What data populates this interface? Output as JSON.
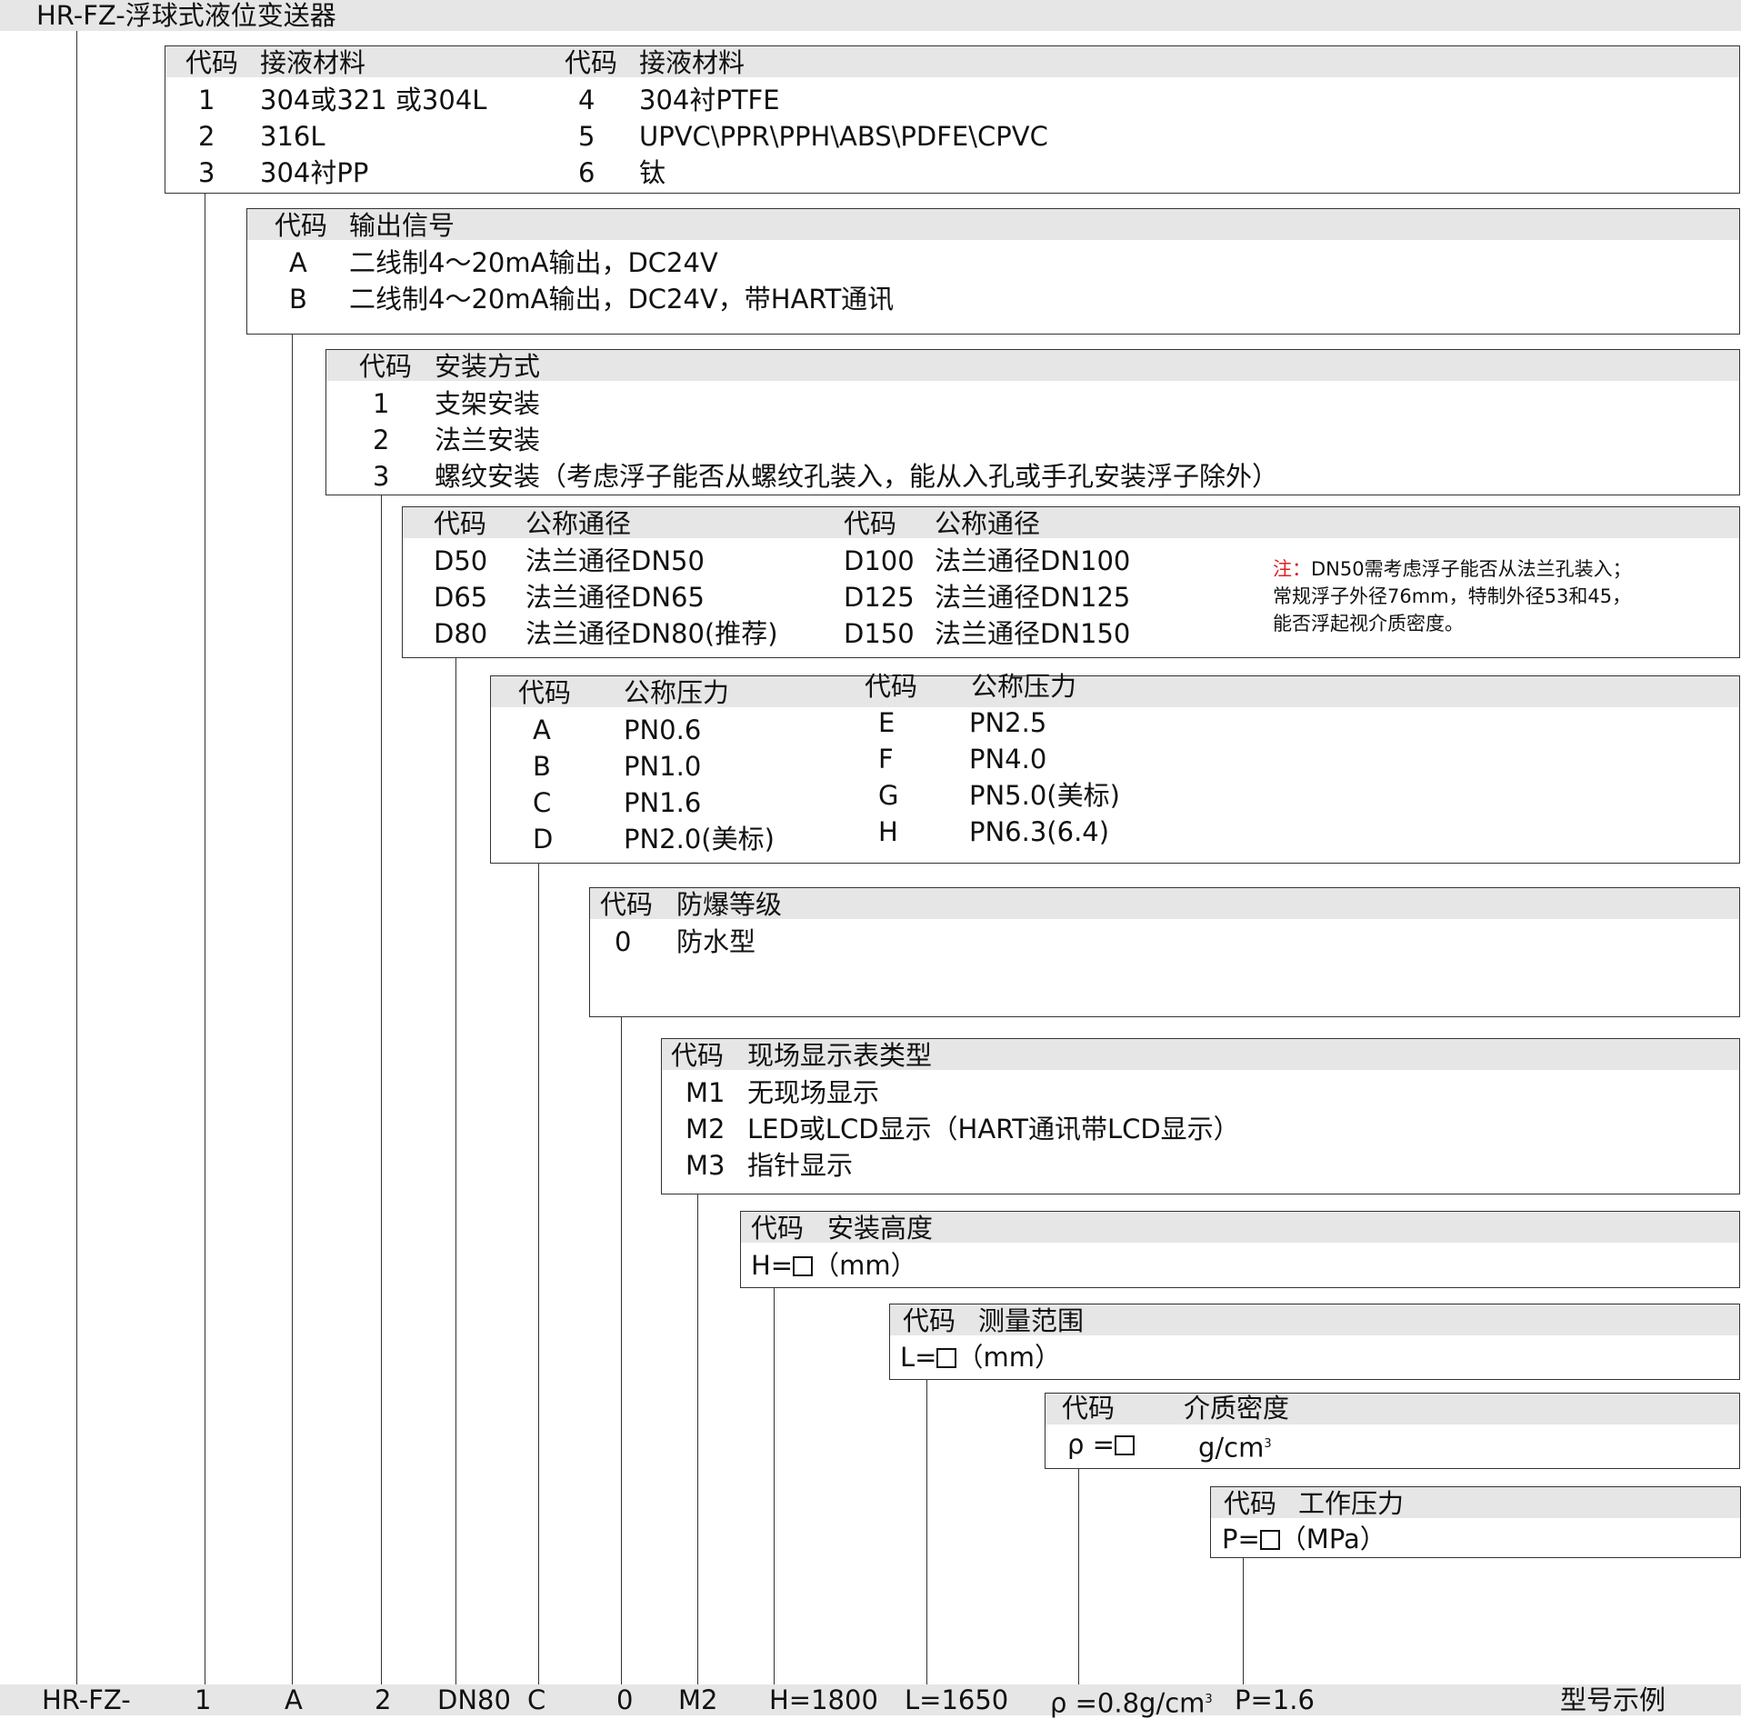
{
  "title": "HR-FZ-浮球式液位变送器",
  "material": {
    "col1_code": "代码",
    "col1_name": "接液材料",
    "col2_code": "代码",
    "col2_name": "接液材料",
    "rows_left": [
      [
        "1",
        "304或321 或304L"
      ],
      [
        "2",
        "316L"
      ],
      [
        "3",
        "304衬PP"
      ]
    ],
    "rows_right": [
      [
        "4",
        "304衬PTFE"
      ],
      [
        "5",
        "UPVC\\PPR\\PPH\\ABS\\PDFE\\CPVC"
      ],
      [
        "6",
        "钛"
      ]
    ]
  },
  "output": {
    "code": "代码",
    "name": "输出信号",
    "rows": [
      [
        "A",
        "二线制4～20mA输出，DC24V"
      ],
      [
        "B",
        "二线制4～20mA输出，DC24V，带HART通讯"
      ]
    ]
  },
  "install": {
    "code": "代码",
    "name": "安装方式",
    "rows": [
      [
        "1",
        "支架安装"
      ],
      [
        "2",
        "法兰安装"
      ],
      [
        "3",
        "螺纹安装（考虑浮子能否从螺纹孔装入，能从入孔或手孔安装浮子除外）"
      ]
    ]
  },
  "dn": {
    "col1_code": "代码",
    "col1_name": "公称通径",
    "col2_code": "代码",
    "col2_name": "公称通径",
    "rows_left": [
      [
        "D50",
        "法兰通径DN50"
      ],
      [
        "D65",
        "法兰通径DN65"
      ],
      [
        "D80",
        "法兰通径DN80(推荐)"
      ]
    ],
    "rows_right": [
      [
        "D100",
        "法兰通径DN100"
      ],
      [
        "D125",
        "法兰通径DN125"
      ],
      [
        "D150",
        "法兰通径DN150"
      ]
    ],
    "note_prefix": "注：",
    "note_line1": "DN50需考虑浮子能否从法兰孔装入；",
    "note_line2": "常规浮子外径76mm，特制外径53和45，",
    "note_line3": "能否浮起视介质密度。"
  },
  "pressure": {
    "col1_code": "代码",
    "col1_name": "公称压力",
    "col2_code": "代码",
    "col2_name": "公称压力",
    "rows_left": [
      [
        "A",
        "PN0.6"
      ],
      [
        "B",
        "PN1.0"
      ],
      [
        "C",
        "PN1.6"
      ],
      [
        "D",
        "PN2.0(美标)"
      ]
    ],
    "rows_right": [
      [
        "E",
        "PN2.5"
      ],
      [
        "F",
        "PN4.0"
      ],
      [
        "G",
        "PN5.0(美标)"
      ],
      [
        "H",
        "PN6.3(6.4)"
      ]
    ]
  },
  "explosion": {
    "code": "代码",
    "name": "防爆等级",
    "rows": [
      [
        "0",
        "防水型"
      ]
    ]
  },
  "display": {
    "code": "代码",
    "name": "现场显示表类型",
    "rows": [
      [
        "M1",
        "无现场显示"
      ],
      [
        "M2",
        "LED或LCD显示（HART通讯带LCD显示）"
      ],
      [
        "M3",
        "指针显示"
      ]
    ]
  },
  "height": {
    "code": "代码",
    "name": "安装高度",
    "prefix": "H=",
    "unit": "（mm）"
  },
  "range": {
    "code": "代码",
    "name": "测量范围",
    "prefix": "L=",
    "unit": "（mm）"
  },
  "density": {
    "code": "代码",
    "name": "介质密度",
    "prefix": "ρ =",
    "unit": "g/cm",
    "unit_sup": "3"
  },
  "work_pressure": {
    "code": "代码",
    "name": "工作压力",
    "prefix": "P=",
    "unit": "（MPa）"
  },
  "example": {
    "parts": [
      "HR-FZ-",
      "1",
      "A",
      "2",
      "DN80",
      "C",
      "0",
      "M2",
      "H=1800",
      "L=1650",
      "ρ =0.8g/cm",
      "P=1.6"
    ],
    "density_sup": "3",
    "label": "型号示例"
  }
}
